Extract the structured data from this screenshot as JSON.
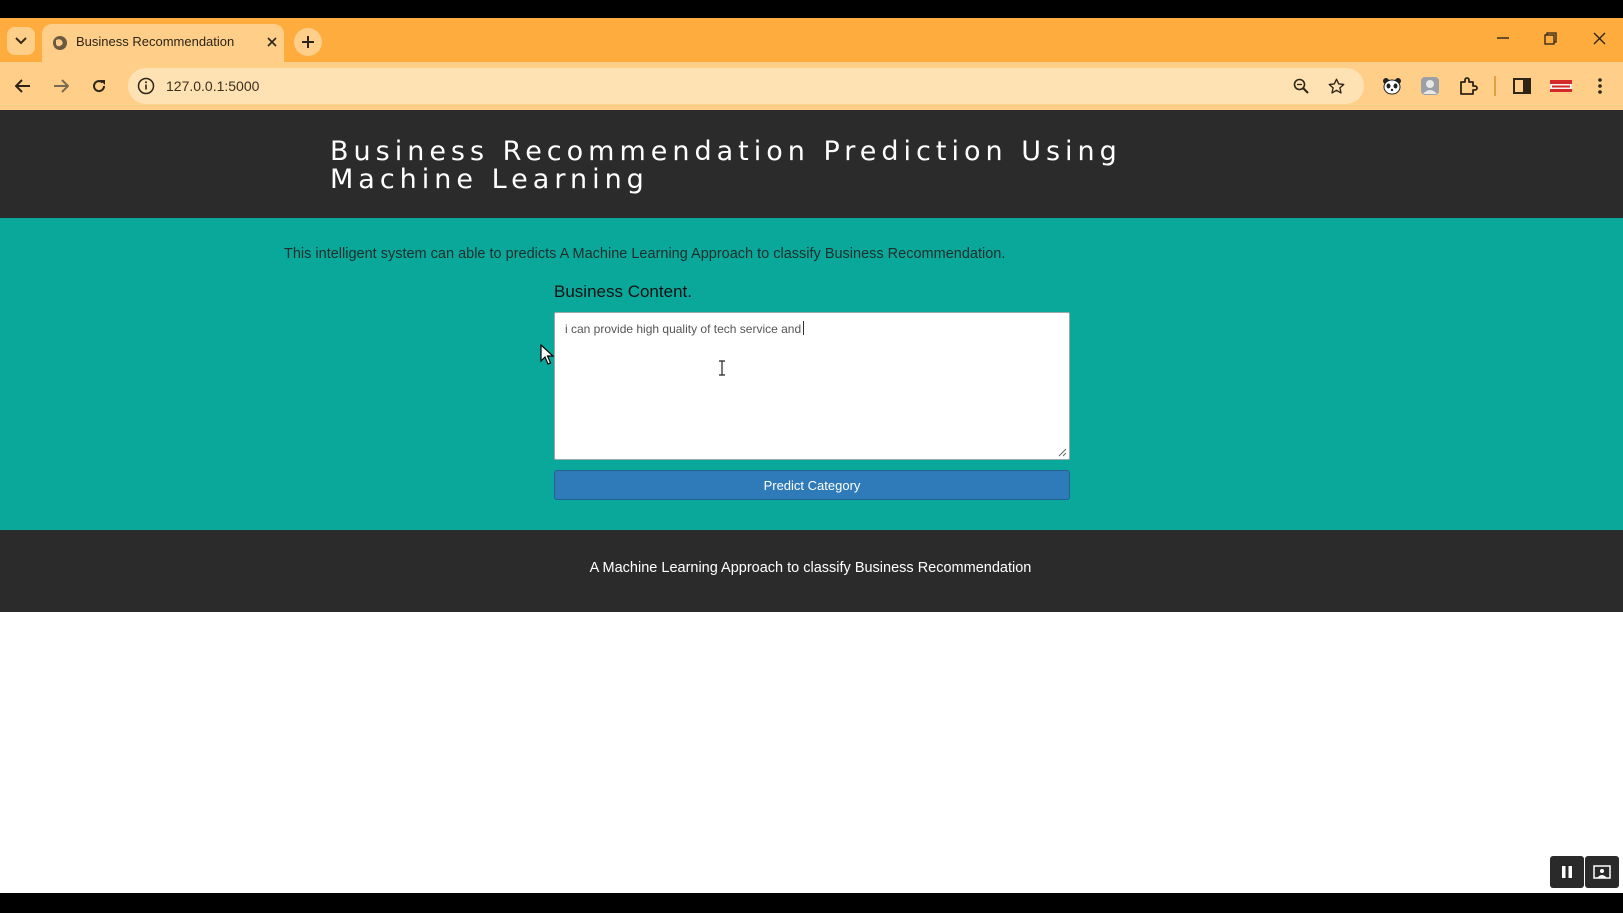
{
  "browser": {
    "tab_title": "Business Recommendation",
    "url": "127.0.0.1:5000",
    "icons": [
      "tab-list-icon",
      "globe-icon",
      "close-icon",
      "plus-icon",
      "minimize-icon",
      "restore-icon",
      "window-close-icon",
      "back-icon",
      "forward-icon",
      "reload-icon",
      "info-icon",
      "zoom-icon",
      "star-icon",
      "panda-extension-icon",
      "profile-extension-icon",
      "puzzle-icon",
      "side-panel-icon",
      "flag-extension-icon",
      "menu-icon"
    ]
  },
  "page": {
    "header_title": "Business Recommendation Prediction Using Machine Learning",
    "intro_text": "This intelligent system can able to predicts A Machine Learning Approach to classify Business Recommendation.",
    "form_label": "Business Content.",
    "textarea_value": "i can provide high quality of tech service and",
    "submit_label": "Predict Category",
    "footer_text": "A Machine Learning Approach to classify Business Recommendation"
  },
  "colors": {
    "tabstrip": "#ffac3f",
    "toolbar": "#ffcf8a",
    "header_bg": "#2b2b2b",
    "main_bg": "#0aa89a",
    "button": "#2f7ab9"
  }
}
